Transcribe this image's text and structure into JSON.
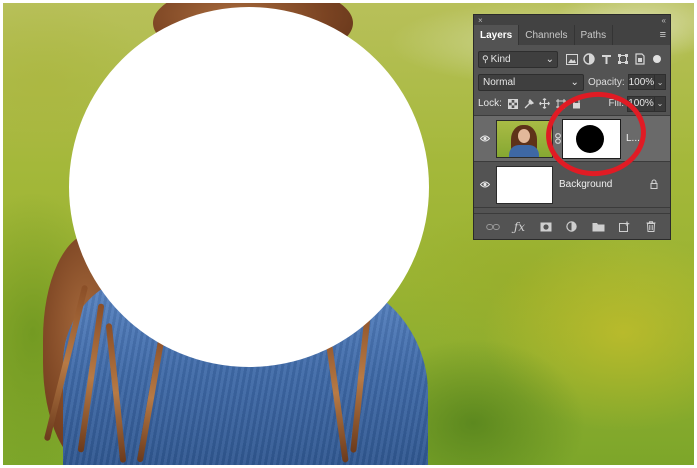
{
  "panel": {
    "close_glyph": "×",
    "collapse_glyph": "«",
    "menu_glyph": "≡",
    "tabs": [
      {
        "label": "Layers",
        "active": true
      },
      {
        "label": "Channels",
        "active": false
      },
      {
        "label": "Paths",
        "active": false
      }
    ],
    "filter": {
      "label": "Kind",
      "search_glyph": "⚲",
      "arrow": "⌄"
    },
    "blend_mode": {
      "value": "Normal",
      "arrow": "⌄"
    },
    "opacity": {
      "label": "Opacity:",
      "value": "100%",
      "arrow": "⌄"
    },
    "lock": {
      "label": "Lock:"
    },
    "fill": {
      "label": "Fill:",
      "value": "100%",
      "arrow": "⌄"
    },
    "layers": [
      {
        "name": "L...",
        "visible": true,
        "selected": true,
        "has_mask": true
      },
      {
        "name": "Background",
        "visible": true,
        "selected": false,
        "locked": true
      }
    ]
  },
  "colors": {
    "panel_bg": "#535353",
    "panel_dark": "#424242",
    "highlight": "#e01b24",
    "selected_row": "#6a6a6a"
  },
  "icons": {
    "filter": [
      "image-filter-icon",
      "adjustment-filter-icon",
      "type-filter-icon",
      "shape-filter-icon",
      "smart-object-filter-icon"
    ],
    "lock": [
      "lock-transparent-icon",
      "lock-image-icon",
      "lock-position-icon",
      "lock-artboard-icon",
      "lock-all-icon"
    ],
    "bottom": [
      "link-layers-icon",
      "fx-icon",
      "add-mask-icon",
      "adjustment-layer-icon",
      "new-group-icon",
      "new-layer-icon",
      "trash-icon"
    ]
  }
}
